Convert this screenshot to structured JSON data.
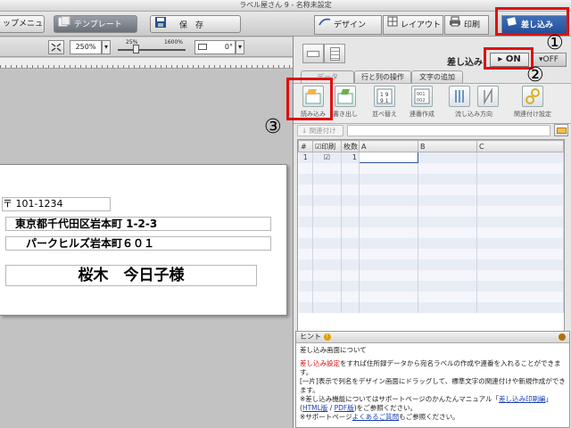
{
  "window": {
    "title": "ラベル屋さん 9 - 名称未設定"
  },
  "toolbar": {
    "menu_label": "ップメニュー",
    "template_label": "テンプレート",
    "save_label": "保　存",
    "zoom_value": "250%",
    "slider_min": "25%",
    "slider_max": "1600%",
    "rotation_value": "0°"
  },
  "mode_tabs": [
    {
      "label": "デザイン"
    },
    {
      "label": "レイアウト"
    },
    {
      "label": "印刷"
    },
    {
      "label": "差し込み"
    }
  ],
  "merge": {
    "label": "差し込み",
    "on_label": "ON",
    "off_label": "OFF"
  },
  "data_tabs": [
    {
      "label": "データ"
    },
    {
      "label": "行と列の操作"
    },
    {
      "label": "文字の追加"
    }
  ],
  "tools": [
    {
      "label": "読み込み"
    },
    {
      "label": "書き出し"
    },
    {
      "label": "並べ替え"
    },
    {
      "label": "連番作成"
    },
    {
      "label": "流し込み方向"
    },
    {
      "label": "関連付け設定"
    }
  ],
  "link_button": "関連付け",
  "grid": {
    "headers": [
      "#",
      "印刷",
      "枚数",
      "A",
      "B",
      "C"
    ],
    "rows": [
      {
        "num": "1",
        "count": "1"
      }
    ]
  },
  "label_preview": {
    "postal": "〒 101-1234",
    "address1": "東京都千代田区岩本町 1-2-3",
    "address2": "パークヒルズ岩本町６０１",
    "name": "桜木　今日子様"
  },
  "hint": {
    "title": "ヒント",
    "heading": "差し込み画面について",
    "p1_red": "差し込み設定",
    "p1_rest": "をすれば住所録データから宛名ラベルの作成や連番を入れることができます。",
    "p2": "[一片]表示で列名をデザイン画面にドラッグして、標準文字の関連付けや新規作成ができます。",
    "p3_pre": "※差し込み機能についてはサポートページのかんたんマニュアル「",
    "p3_red": "差し込み印刷編",
    "p3_close": "」",
    "p3_link1": "HTML版",
    "p3_sep": " / ",
    "p3_link2": "PDF版",
    "p3_post": ")をご参照ください。",
    "p4_pre": "※サポートページ",
    "p4_link": "よくあるご質問",
    "p4_post": "もご参照ください。"
  },
  "annotations": [
    "①",
    "②",
    "③"
  ],
  "colors": {
    "highlight": "#e01010",
    "active_tab": "#2a5aa8",
    "link": "#1a3fb0"
  }
}
